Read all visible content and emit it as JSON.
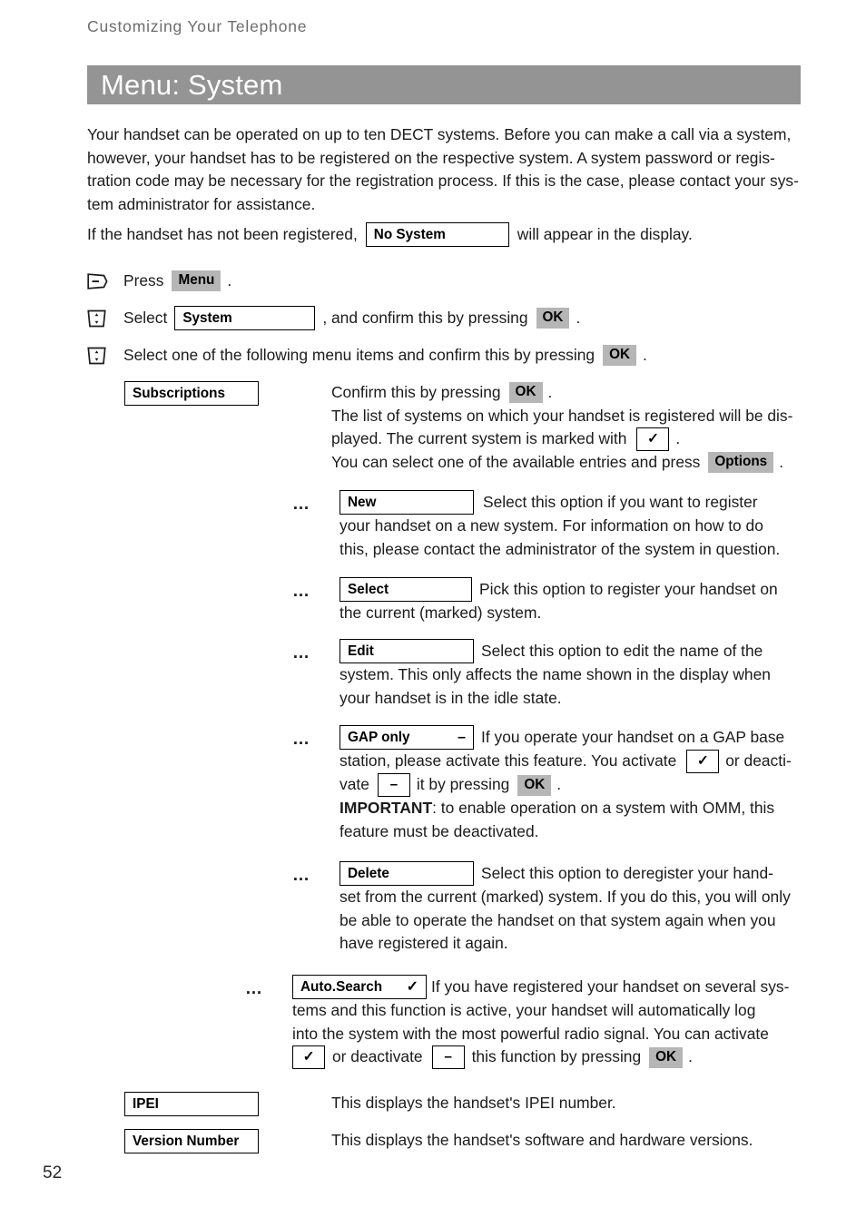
{
  "page": {
    "running_head": "Customizing Your Telephone",
    "banner_title": "Menu: System",
    "page_number": "52",
    "banner_color": "#949494",
    "key_chip_color": "#b6b6b6"
  },
  "intro": {
    "line1": "Your handset can be operated on up to ten DECT systems. Before you can make a call via a system,",
    "line2": "however, your handset has to be registered on the respective system. A system password or regis-",
    "line3": "tration code may be necessary for the registration process. If this is the case, please contact your sys-",
    "line4": "tem administrator for assistance.",
    "registered_prefix": "If the handset has not been registered,",
    "registered_box": "No System",
    "registered_suffix": "will appear in the display."
  },
  "steps": {
    "press": {
      "icon": "softkey-icon",
      "label": "Press",
      "key": "Menu",
      "period": "."
    },
    "select_system": {
      "icon": "navkey-icon",
      "label": "Select",
      "box": "System",
      "mid": ", and confirm this by pressing",
      "key": "OK",
      "period": "."
    },
    "select_items": {
      "icon": "navkey-icon",
      "label": "Select one of the following menu items and confirm this by pressing",
      "key": "OK",
      "period": "."
    }
  },
  "subscriptions": {
    "box": "Subscriptions",
    "line1_pre": "Confirm this by pressing",
    "line1_key": "OK",
    "line1_post": ".",
    "line2": "The list of systems on which your handset is registered will be dis-",
    "line3_pre": "played. The current system is marked with",
    "line3_mark": "✓",
    "line3_post": ".",
    "line4_pre": "You can select one of the available entries and press",
    "line4_key": "Options",
    "line4_post": ".",
    "items": [
      {
        "dots": "…",
        "box": "New",
        "mark": "",
        "text_first": "Select this option if you want to register",
        "lines": [
          "your handset on a new system. For information on how to do",
          "this, please contact the administrator of the system in question."
        ]
      },
      {
        "dots": "…",
        "box": "Select",
        "mark": "",
        "text_first": "Pick this option to register your handset on",
        "lines": [
          "the current (marked) system."
        ]
      },
      {
        "dots": "…",
        "box": "Edit",
        "mark": "",
        "text_first": "Select this option to edit the name of the",
        "lines": [
          "system. This only affects the name shown in the display when",
          "your handset is in the idle state."
        ]
      },
      {
        "dots": "…",
        "box": "GAP only",
        "mark": "–",
        "text_first": "If you operate your handset on a GAP base",
        "lines": []
      },
      {
        "dots": "…",
        "box": "Delete",
        "mark": "",
        "text_first": "Select this option to deregister your hand-",
        "lines": [
          "set from the current (marked) system. If you do this, you will only",
          "be able to operate the handset on that system again when you",
          "have registered it again."
        ]
      }
    ],
    "gap_detail": {
      "line2_pre": "station, please activate this feature. You activate",
      "line2_mark": "✓",
      "line2_post": "or deacti-",
      "line3_pre": "vate",
      "line3_mark": "–",
      "line3_mid": "it by pressing",
      "line3_key": "OK",
      "line3_post": ".",
      "important_label": "IMPORTANT",
      "important_text": ": to enable operation on a system with OMM, this",
      "important_line2": "feature must be deactivated."
    },
    "auto_search": {
      "dots": "…",
      "box": "Auto.Search",
      "mark": "✓",
      "text_first": "If you have registered your handset on several sys-",
      "line2": "tems and this function is active, your handset will automatically log",
      "line3": "into the system with the most powerful radio signal. You can activate",
      "line4_mark_on": "✓",
      "line4_mid": "or deactivate",
      "line4_mark_off": "–",
      "line4_tail": "this function by pressing",
      "line4_key": "OK",
      "line4_post": "."
    }
  },
  "other_entries": [
    {
      "box": "IPEI",
      "desc": "This displays the handset's IPEI number."
    },
    {
      "box": "Version Number",
      "desc": "This displays the handset's software and hardware versions."
    }
  ]
}
